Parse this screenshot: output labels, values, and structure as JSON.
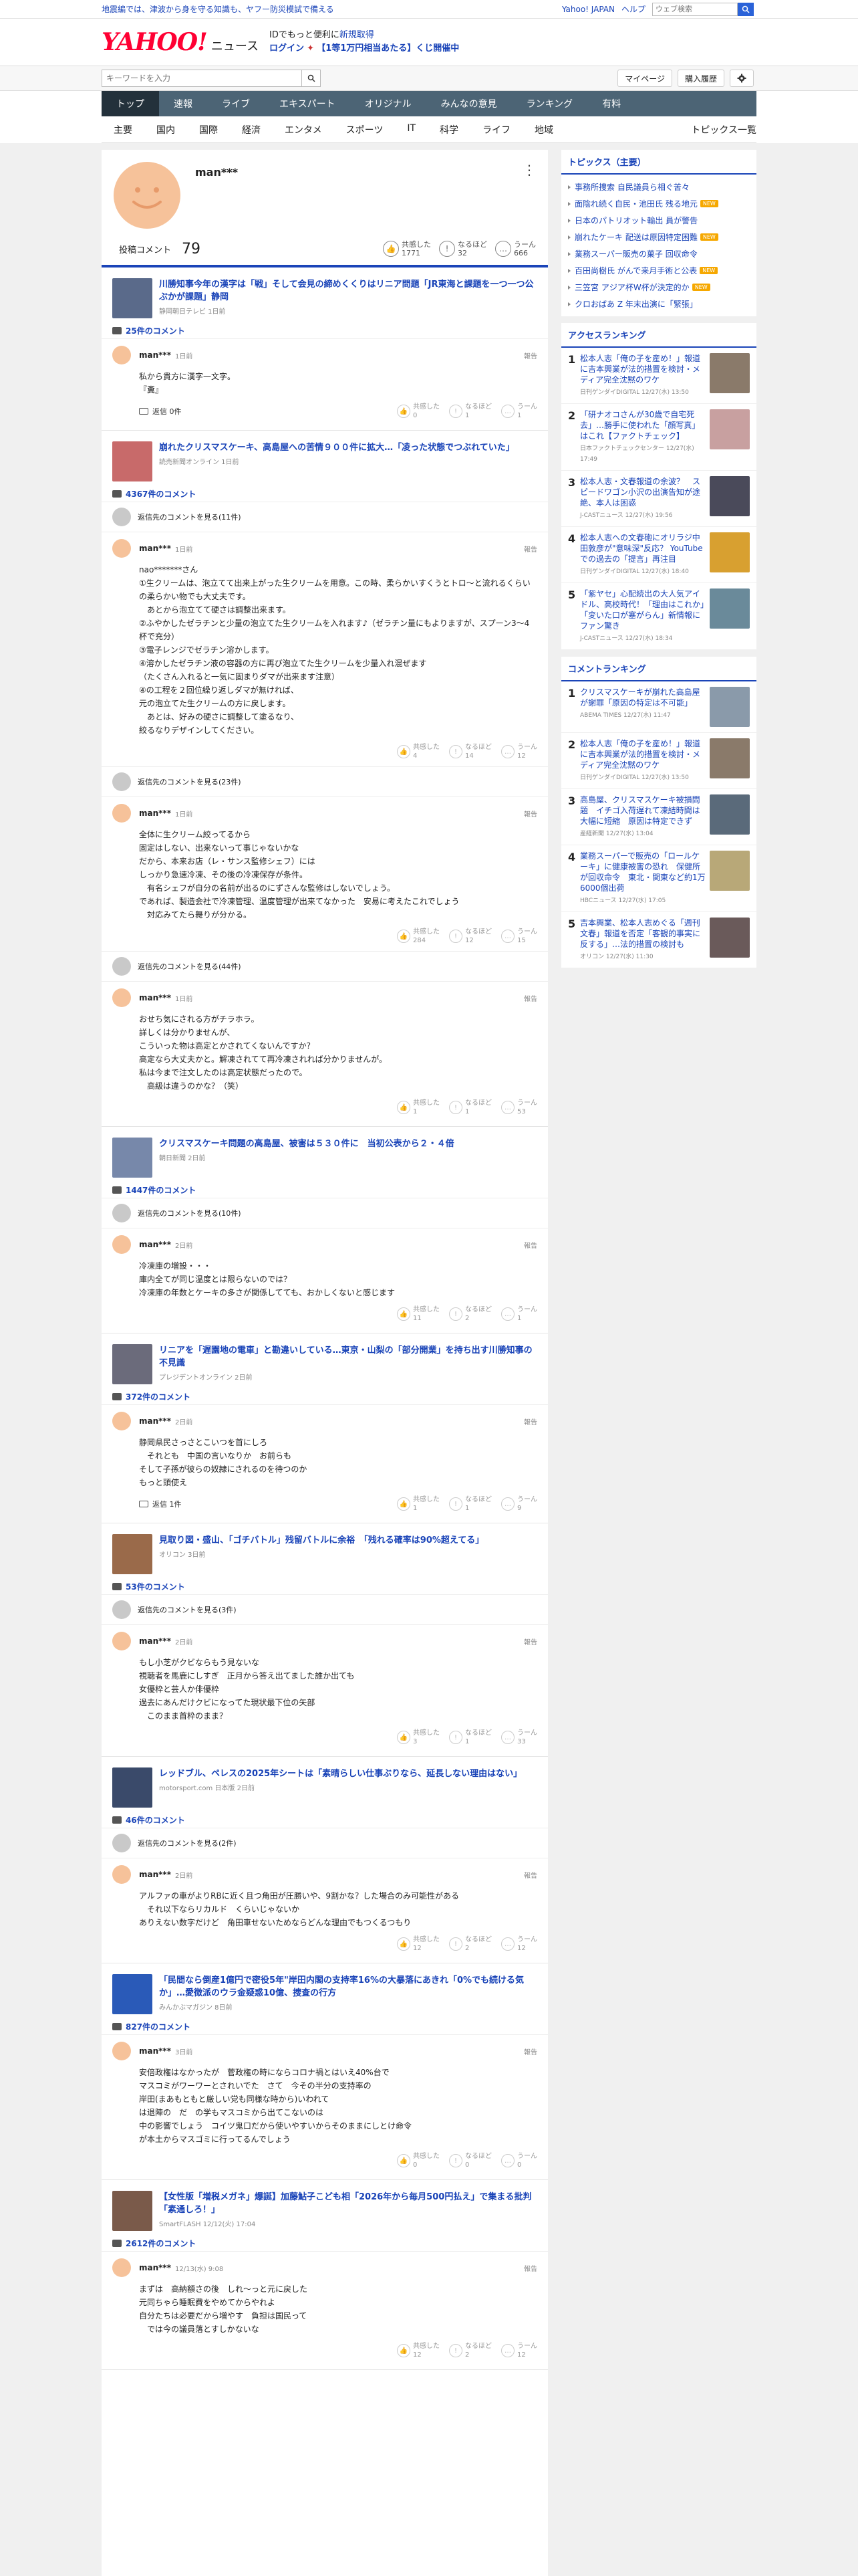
{
  "topbar": {
    "notice": "地震編では、津波から身を守る知識も、ヤフー防災模試で備える",
    "links": [
      "Yahoo! JAPAN",
      "ヘルプ"
    ],
    "search_placeholder": "ウェブ検索"
  },
  "header": {
    "logo": "YAHOO!",
    "logo_sub": "ニュース",
    "promo_line1": "IDでもっと便利に",
    "promo_new": "新規取得",
    "promo_login": "ログイン",
    "promo_line2": "【1等1万円相当あたる】くじ開催中"
  },
  "subbar": {
    "keyword_placeholder": "キーワードを入力",
    "mypage": "マイページ",
    "history": "購入履歴"
  },
  "gnav": [
    "トップ",
    "速報",
    "ライブ",
    "エキスパート",
    "オリジナル",
    "みんなの意見",
    "ランキング",
    "有料"
  ],
  "cnav": {
    "cats": [
      "主要",
      "国内",
      "国際",
      "経済",
      "エンタメ",
      "スポーツ",
      "IT",
      "科学",
      "ライフ",
      "地域"
    ],
    "right": "トピックス一覧"
  },
  "profile": {
    "name": "man***",
    "label": "投稿コメント",
    "count": "79",
    "rx": [
      {
        "label": "共感した",
        "count": "1771"
      },
      {
        "label": "なるほど",
        "count": "32"
      },
      {
        "label": "うーん",
        "count": "666"
      }
    ]
  },
  "blocks": [
    {
      "title": "川勝知事今年の漢字は「戦」そして会見の締めくくりはリニア問題「JR東海と課題を一つ一つ公ぶかが課題」静岡",
      "source": "静岡朝日テレビ 1日前",
      "cc": "25件のコメント",
      "th": "#5a6a8a",
      "items": [
        {
          "type": "cmt",
          "time": "1日前",
          "body": "私から貴方に漢字一文字。\n『糞』",
          "reply": "返信 0件",
          "r": [
            "0",
            "1",
            "1"
          ]
        }
      ]
    },
    {
      "title": "崩れたクリスマスケーキ、高島屋への苦情９００件に拡大…「凌った状態でつぶれていた」",
      "source": "読売新聞オンライン 1日前",
      "cc": "4367件のコメント",
      "th": "#c86a6a",
      "items": [
        {
          "type": "parent",
          "text": "返信先のコメントを見る(11件)"
        },
        {
          "type": "cmt",
          "time": "1日前",
          "body": "nao*******さん\n①生クリームは、泡立てて出来上がった生クリームを用意。この時、柔らかいすくうとトロ〜と流れるくらいの柔らかい物でも大丈夫です。\n　あとから泡立てて硬さは調整出来ます。\n②ふやかしたゼラチンと少量の泡立てた生クリームを入れます♪（ゼラチン量にもよりますが、スプーン3〜4杯で充分）\n③電子レンジでゼラチン溶かします。\n④溶かしたゼラチン液の容器の方に再び泡立てた生クリームを少量入れ混ぜます\n（たくさん入れると一気に固まりダマが出来ます注意）\n④の工程を２回位繰り返しダマが無ければ、\n元の泡立てた生クリームの方に戻します。\n　あとは、好みの硬さに調整して塗るなり、\n絞るなりデザインしてください。",
          "r": [
            "4",
            "14",
            "12"
          ]
        },
        {
          "type": "parent",
          "text": "返信先のコメントを見る(23件)"
        },
        {
          "type": "cmt",
          "time": "1日前",
          "body": "全体に生クリーム絞ってるから\n固定はしない、出来ないって事じゃないかな\nだから、本来お店（レ・サンス監修シェフ）には\nしっかり急速冷凍、その後の冷凍保存が条件。\n　有名シェフが自分の名前が出るのにずさんな監修はしないでしょう。\nであれば、製造会社で冷凍管理、温度管理が出来てなかった　安易に考えたこれでしょう\n　対応みてたら舞りが分かる。",
          "r": [
            "284",
            "12",
            "15"
          ]
        },
        {
          "type": "parent",
          "text": "返信先のコメントを見る(44件)"
        },
        {
          "type": "cmt",
          "time": "1日前",
          "body": "おせち気にされる方がチラホラ。\n詳しくは分かりませんが、\nこういった物は高定とかされてくないんですか？\n高定なら大丈夫かと。解凍されてて再冷凍されれば分かりませんが。\n私は今まで注文したのは高定状態だったので。\n　高級は違うのかな？（笑）",
          "r": [
            "1",
            "1",
            "53"
          ]
        }
      ]
    },
    {
      "title": "クリスマスケーキ問題の高島屋、被害は５３０件に　当初公表から２・４倍",
      "source": "朝日新聞 2日前",
      "cc": "1447件のコメント",
      "th": "#7788aa",
      "items": [
        {
          "type": "parent",
          "text": "返信先のコメントを見る(10件)"
        },
        {
          "type": "cmt",
          "time": "2日前",
          "body": "冷凍庫の増設・・・\n庫内全てが同じ温度とは限らないのでは？\n冷凍庫の年数とケーキの多さが関係してても、おかしくないと感じます",
          "r": [
            "11",
            "2",
            "1"
          ]
        }
      ]
    },
    {
      "title": "リニアを「遅園地の電車」と勘違いしている…東京・山梨の「部分開業」を持ち出す川勝知事の不見識",
      "source": "プレジデントオンライン 2日前",
      "cc": "372件のコメント",
      "th": "#6b6b7b",
      "items": [
        {
          "type": "cmt",
          "time": "2日前",
          "body": "静岡県民さっさとこいつを首にしろ\n　それとも　中国の言いなりか　お前らも\nそして子孫が彼らの奴隷にされるのを待つのか\nもっと頭使え",
          "reply": "返信 1件",
          "r": [
            "1",
            "1",
            "9"
          ]
        }
      ]
    },
    {
      "title": "見取り図・盛山、「ゴチバトル」残留バトルに余裕　「残れる確率は90%超えてる」",
      "source": "オリコン 3日前",
      "cc": "53件のコメント",
      "th": "#9a6a4a",
      "items": [
        {
          "type": "parent",
          "text": "返信先のコメントを見る(3件)"
        },
        {
          "type": "cmt",
          "time": "2日前",
          "body": "もし小芝がクビならもう見ないな\n視聴者を馬鹿にしすぎ　正月から答え出てました誰か出ても\n女優枠と芸人か俳優枠\n過去にあんだけクビになってた現状最下位の矢部\n　このまま首枠のまま？",
          "r": [
            "3",
            "1",
            "33"
          ]
        }
      ]
    },
    {
      "title": "レッドブル、ペレスの2025年シートは「素晴らしい仕事ぶりなら、延長しない理由はない」",
      "source": "motorsport.com 日本版 2日前",
      "cc": "46件のコメント",
      "th": "#3a4a6a",
      "items": [
        {
          "type": "parent",
          "text": "返信先のコメントを見る(2件)"
        },
        {
          "type": "cmt",
          "time": "2日前",
          "body": "アルファの車がよりRBに近く且つ角田が圧勝いや、9割かな？した場合のみ可能性がある\n　それ以下ならリカルド　くらいじゃないか\nありえない数字だけど　角田車せないためならどんな理由でもつくるつもり",
          "r": [
            "12",
            "2",
            "12"
          ]
        }
      ]
    },
    {
      "title": "「民間なら倒産1億円で密役5年\"岸田内閣の支持率16%の大暴落にあきれ「0%でも続ける気か」…愛徴派のウラ金疑惑10億、捜査の行方",
      "source": "みんかぶマガジン 8日前",
      "cc": "827件のコメント",
      "th": "#2a5ab8",
      "items": [
        {
          "type": "cmt",
          "time": "3日前",
          "body": "安倍政権はなかったが　菅政権の時にならコロナ禍とはいえ40%台で\nマスコミがワーワーとされいでた　さて　今その半分の支持率の\n岸田(まあもともと厳しい党も同様な時から)いわれて\nは退陣の　だ　の学もマスコミから出てこないのは\n中の影響でしょう　コイツ鬼口だから使いやすいからそのままにしとけ命令\nが本土からマスゴミに行ってるんでしょう",
          "r": [
            "0",
            "0",
            "0"
          ]
        }
      ]
    },
    {
      "title": "【女性版「増税メガネ」爆誕】加藤鮎子こども相「2026年から毎月500円払え」で集まる批判「素通しろ！」",
      "source": "SmartFLASH 12/12(火) 17:04",
      "cc": "2612件のコメント",
      "th": "#7a5a4a",
      "items": [
        {
          "type": "cmt",
          "time": "12/13(水) 9:08",
          "body": "まずは　高納額さの後　しれ〜っと元に戻した\n元同ちゃら睡眠費をやめてからやれよ\n自分たちは必要だから増やす　負担は国民って\n　では今の議員落とすしかないな",
          "r": [
            "12",
            "2",
            "12"
          ]
        }
      ]
    }
  ],
  "side": {
    "topics_title": "トピックス（主要）",
    "topics": [
      {
        "t": "事務所捜索 自民議員ら相ぐ苦々",
        "n": false
      },
      {
        "t": "面陰れ続く自民・池田氏 残る地元",
        "n": true
      },
      {
        "t": "日本のパトリオット輸出 員が警告",
        "n": false
      },
      {
        "t": "崩れたケーキ 配送は原因特定困難",
        "n": true
      },
      {
        "t": "業務スーパー販売の菓子 回収命令",
        "n": false
      },
      {
        "t": "百田尚樹氏 がんで来月手術と公表",
        "n": true
      },
      {
        "t": "三笠宮 アジア杯W杯が決定的か",
        "n": true
      },
      {
        "t": "クロおばあ Z 年末出演に「緊張」",
        "n": false
      }
    ],
    "access_title": "アクセスランキング",
    "access": [
      {
        "t": "松本人志「俺の子を産め！」報道に吉本興業が法的措置を検討・メディア完全沈黙のワケ",
        "s": "日刊ゲンダイDIGITAL 12/27(水) 13:50",
        "th": "#8a7a6a"
      },
      {
        "t": "「研ナオコさんが30歳で自宅死去」…勝手に使われた「顔写真」はこれ【ファクトチェック】",
        "s": "日本ファクトチェックセンター 12/27(水) 17:49",
        "th": "#c8a0a0"
      },
      {
        "t": "松本人志・文春報道の余波？　スピードワゴン小沢の出演告知が途絶、本人は困惑",
        "s": "J-CASTニュース 12/27(水) 19:56",
        "th": "#4a4a5a"
      },
      {
        "t": "松本人志への文春砲にオリラジ中田敦彦が\"意味深\"反応？ YouTubeでの過去の「提言」再注目",
        "s": "日刊ゲンダイDIGITAL 12/27(水) 18:40",
        "th": "#d8a030"
      },
      {
        "t": "「紫ヤセ」心配続出の大人気アイドル、高校時代！「理由はこれか」「変いた口が塞がらん」新情報にファン驚き",
        "s": "J-CASTニュース 12/27(水) 18:34",
        "th": "#6a8a9a"
      }
    ],
    "comment_title": "コメントランキング",
    "comments": [
      {
        "t": "クリスマスケーキが崩れた高島屋が謝罪「原因の特定は不可能」",
        "s": "ABEMA TIMES 12/27(水) 11:47",
        "th": "#8a9aaa"
      },
      {
        "t": "松本人志「俺の子を産め！」報道に吉本興業が法的措置を検討・メディア完全沈黙のワケ",
        "s": "日刊ゲンダイDIGITAL 12/27(水) 13:50",
        "th": "#8a7a6a"
      },
      {
        "t": "高島屋、クリスマスケーキ被損問題　イチゴ入荷遅れて凍結時間は大幅に短縮　原因は特定できず",
        "s": "産経新聞 12/27(水) 13:04",
        "th": "#5a6a7a"
      },
      {
        "t": "業務スーパーで販売の「ロールケーキ」に健康被害の恐れ　保健所が回収命令　東北・関東など約1万6000個出荷",
        "s": "HBCニュース 12/27(水) 17:05",
        "th": "#b8a878"
      },
      {
        "t": "吉本興業、松本人志めぐる「週刊文春」報道を否定「客観的事実に反する」…法的措置の検討も",
        "s": "オリコン 12/27(水) 11:30",
        "th": "#6a5a5a"
      }
    ]
  }
}
